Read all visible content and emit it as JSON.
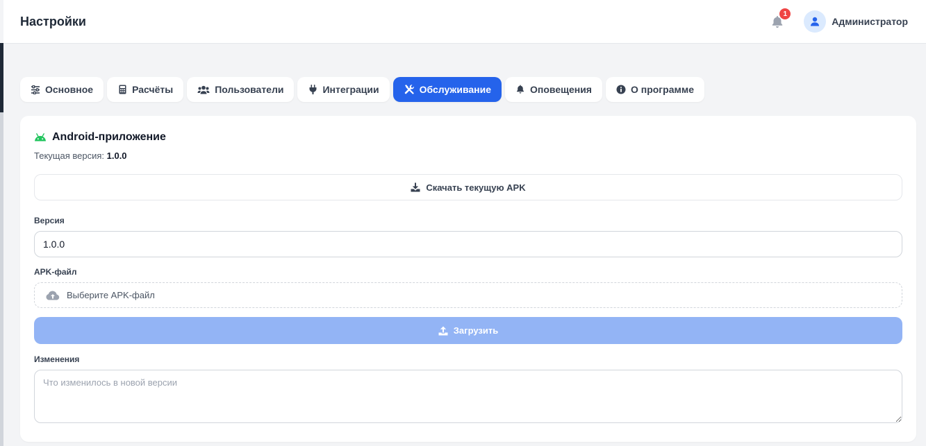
{
  "header": {
    "title": "Настройки",
    "notifications_count": "1",
    "user_name": "Администратор"
  },
  "tabs": [
    {
      "label": "Основное",
      "icon": "sliders-icon",
      "active": false
    },
    {
      "label": "Расчёты",
      "icon": "calculator-icon",
      "active": false
    },
    {
      "label": "Пользователи",
      "icon": "users-icon",
      "active": false
    },
    {
      "label": "Интеграции",
      "icon": "plug-icon",
      "active": false
    },
    {
      "label": "Обслуживание",
      "icon": "tools-icon",
      "active": true
    },
    {
      "label": "Оповещения",
      "icon": "bell-icon",
      "active": false
    },
    {
      "label": "О программе",
      "icon": "info-icon",
      "active": false
    }
  ],
  "android": {
    "title": "Android-приложение",
    "current_version_label": "Текущая версия:",
    "current_version": "1.0.0",
    "download_label": "Скачать текущую APK",
    "version_label": "Версия",
    "version_value": "1.0.0",
    "apk_label": "APK-файл",
    "apk_placeholder": "Выберите APK-файл",
    "upload_label": "Загрузить",
    "changes_label": "Изменения",
    "changes_placeholder": "Что изменилось в новой версии"
  },
  "colors": {
    "accent": "#2563eb",
    "upload_disabled": "#93b4f5",
    "android_green": "#22c55e",
    "badge_red": "#ef4444"
  }
}
